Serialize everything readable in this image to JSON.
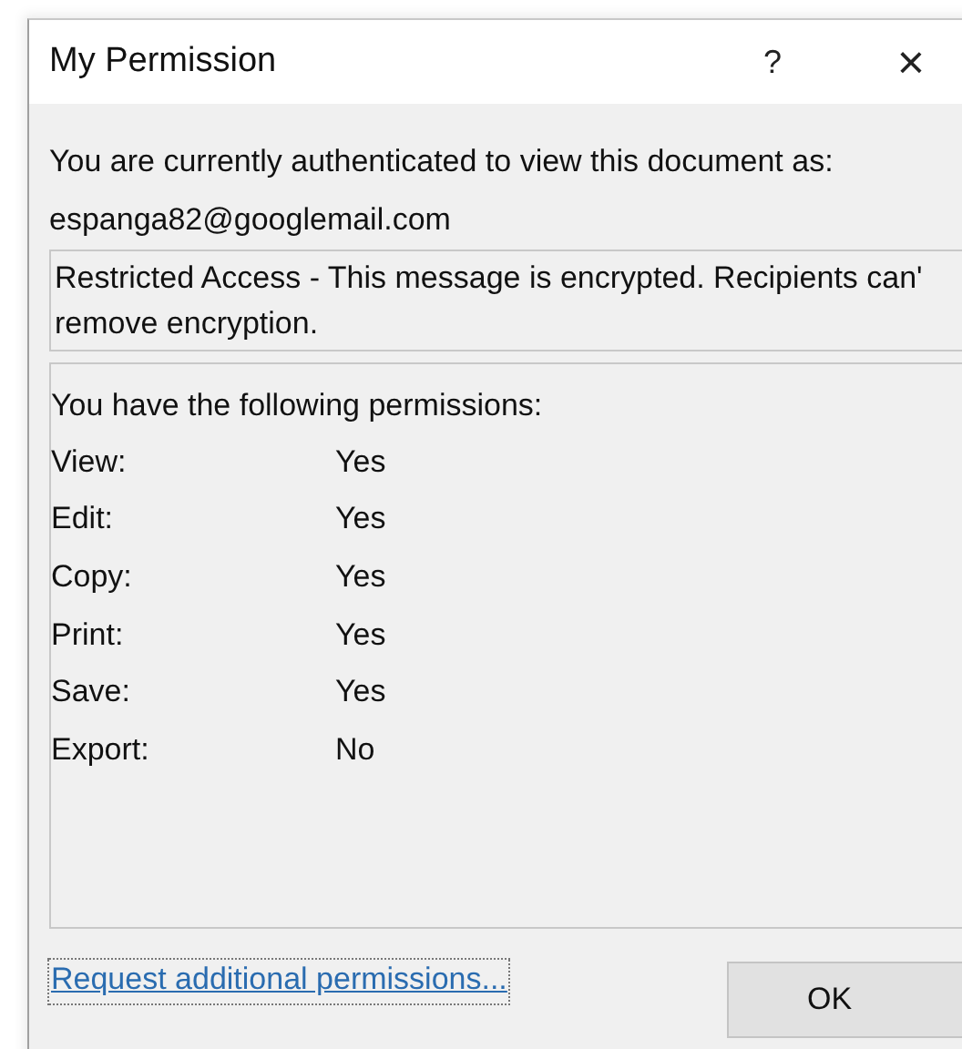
{
  "window": {
    "title": "My Permission",
    "help": "?",
    "close": "×"
  },
  "intro": "You are currently authenticated to view this document as:",
  "account": "espanga82@googlemail.com",
  "notice": "Restricted Access - This message is encrypted. Recipients can' remove encryption.",
  "permissions": {
    "heading": "You have the following permissions:",
    "rows": [
      {
        "label": "View:",
        "value": "Yes"
      },
      {
        "label": "Edit:",
        "value": "Yes"
      },
      {
        "label": "Copy:",
        "value": "Yes"
      },
      {
        "label": "Print:",
        "value": "Yes"
      },
      {
        "label": "Save:",
        "value": "Yes"
      },
      {
        "label": "Export:",
        "value": "No"
      }
    ]
  },
  "link": "Request additional permissions...",
  "buttons": [
    "OK"
  ]
}
